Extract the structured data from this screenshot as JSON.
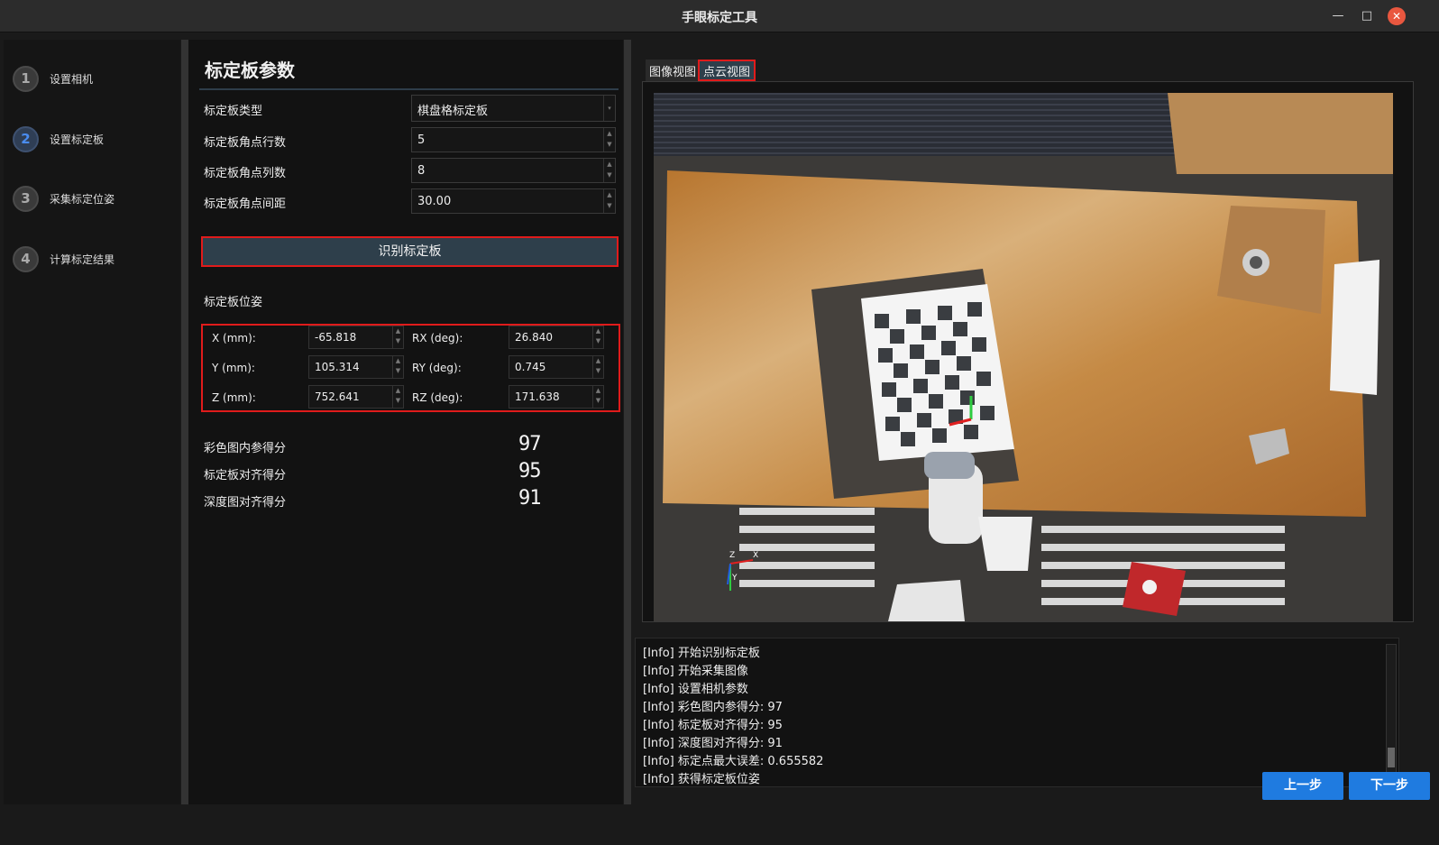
{
  "window": {
    "title": "手眼标定工具",
    "min_icon": "—",
    "max_icon": "□",
    "close_icon": "✕"
  },
  "steps": [
    {
      "num": "1",
      "label": "设置相机",
      "active": false
    },
    {
      "num": "2",
      "label": "设置标定板",
      "active": true
    },
    {
      "num": "3",
      "label": "采集标定位姿",
      "active": false
    },
    {
      "num": "4",
      "label": "计算标定结果",
      "active": false
    }
  ],
  "params": {
    "title": "标定板参数",
    "board_type_label": "标定板类型",
    "board_type_value": "棋盘格标定板",
    "rows_label": "标定板角点行数",
    "rows_value": "5",
    "cols_label": "标定板角点列数",
    "cols_value": "8",
    "spacing_label": "标定板角点间距",
    "spacing_value": "30.00",
    "detect_button": "识别标定板"
  },
  "pose": {
    "title": "标定板位姿",
    "x_label": "X (mm):",
    "x_value": "-65.818",
    "y_label": "Y (mm):",
    "y_value": "105.314",
    "z_label": "Z (mm):",
    "z_value": "752.641",
    "rx_label": "RX (deg):",
    "rx_value": "26.840",
    "ry_label": "RY (deg):",
    "ry_value": "0.745",
    "rz_label": "RZ (deg):",
    "rz_value": "171.638"
  },
  "scores": [
    {
      "label": "彩色图内参得分",
      "value": "97"
    },
    {
      "label": "标定板对齐得分",
      "value": "95"
    },
    {
      "label": "深度图对齐得分",
      "value": "91"
    }
  ],
  "tabs": {
    "image_view": "图像视图",
    "pointcloud_view": "点云视图",
    "active": "点云视图"
  },
  "axes": {
    "z": "Z",
    "x": "X",
    "y": "Y"
  },
  "log": [
    "[Info] 开始识别标定板",
    "[Info] 开始采集图像",
    "[Info] 设置相机参数",
    "[Info] 彩色图内参得分:  97",
    "[Info] 标定板对齐得分:  95",
    "[Info] 深度图对齐得分:  91",
    "[Info] 标定点最大误差:  0.655582",
    "[Info] 获得标定板位姿"
  ],
  "nav": {
    "prev": "上一步",
    "next": "下一步"
  },
  "colors": {
    "accent": "#1f7be0",
    "highlight": "#e01b1b",
    "active_step": "#4a8cf0"
  }
}
